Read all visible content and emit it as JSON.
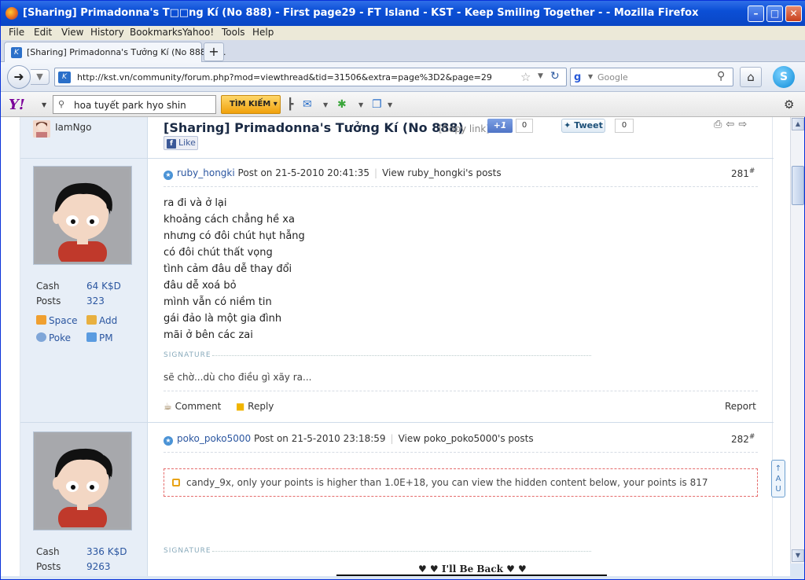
{
  "window": {
    "title": "[Sharing] Primadonna's T□□ng Kí (No 888) - First page29 - FT Island - KST - Keep Smiling Together - - Mozilla Firefox"
  },
  "menu": [
    "File",
    "Edit",
    "View",
    "History",
    "Bookmarks",
    "Yahoo!",
    "Tools",
    "Help"
  ],
  "tab": {
    "title": "[Sharing] Primadonna's Tưởng Kí (No 888) - ...",
    "new_tab": "+"
  },
  "nav": {
    "url": "http://kst.vn/community/forum.php?mod=viewthread&tid=31506&extra=page%3D2&page=29",
    "search_placeholder": "Google"
  },
  "yahoo_bar": {
    "logo": "Y!",
    "search_value": "hoa tuyết park hyo shin",
    "search_button": "TÌM KIẾM"
  },
  "thread": {
    "top_user": "IamNgo",
    "title": "[Sharing] Primadonna's Tưởng Kí (No 888)",
    "copy_link": "[Copy link]",
    "plus_one": "+1",
    "plus_one_count": "0",
    "tweet": "Tweet",
    "tweet_count": "0",
    "fb_like": "Like"
  },
  "posts": [
    {
      "author": "ruby_hongki",
      "posted": "Post on 21-5-2010 20:41:35",
      "view_posts": "View ruby_hongki's posts",
      "floor": "281",
      "floor_mark": "#",
      "cash_label": "Cash",
      "cash": "64 K$D",
      "posts_label": "Posts",
      "posts": "323",
      "links": [
        "Space",
        "Add",
        "Poke",
        "PM"
      ],
      "lines": [
        "ra đi và ở lại",
        "khoảng cách chẳng hề xa",
        "nhưng có đôi chút hụt hẫng",
        "có đôi chút thất vọng",
        "tình cảm đâu dễ thay đổi",
        "đâu dễ xoá bỏ",
        "mình vẫn có niềm tin",
        "gái đảo là một gia đình",
        "mãi ở bên các zai"
      ],
      "signature_label": "SIGNATURE",
      "signature": "sẽ chờ...dù cho điều gì xãy ra...",
      "actions": {
        "comment": "Comment",
        "reply": "Reply",
        "report": "Report"
      }
    },
    {
      "author": "poko_poko5000",
      "posted": "Post on 21-5-2010 23:18:59",
      "view_posts": "View poko_poko5000's posts",
      "floor": "282",
      "floor_mark": "#",
      "cash_label": "Cash",
      "cash": "336 K$D",
      "posts_label": "Posts",
      "posts": "9263",
      "hidden_notice": "candy_9x, only your points is higher than 1.0E+18, you can view the hidden content below, your points is 817",
      "signature_label": "SIGNATURE",
      "signature": "♥ ♥ I'll Be Back ♥ ♥"
    }
  ],
  "side_button": "↑\nA\nU"
}
